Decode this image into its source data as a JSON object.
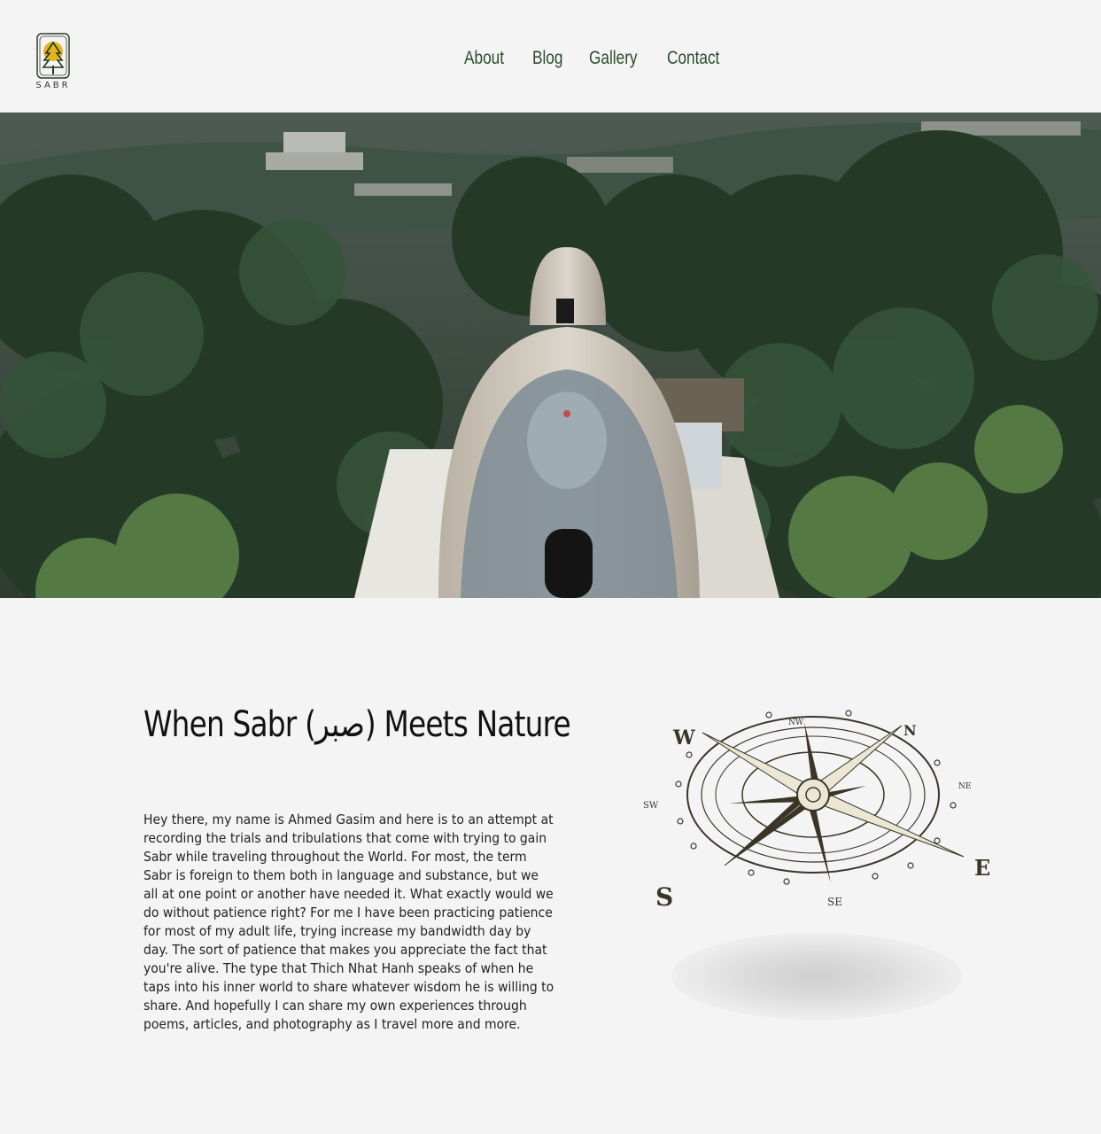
{
  "brand": {
    "name": "SABR",
    "icon": "tree-sun-logo-icon"
  },
  "nav": {
    "about": "About",
    "blog": "Blog",
    "gallery": "Gallery",
    "contact": "Contact"
  },
  "hero": {
    "image": "forest-dome-mural-photo"
  },
  "main": {
    "title": "When Sabr (صبر) Meets Nature",
    "intro": "Hey there, my name is Ahmed Gasim and here is to an attempt at recording the trials and tribulations that come with trying to gain Sabr while traveling throughout the World. For most, the term Sabr is foreign to them both in language and substance, but we all at one point or another have needed it. What exactly would we do without patience right? For me I have been practicing patience for most of my adult life, trying increase my bandwidth day by day. The sort of patience that makes you appreciate the fact that you're alive. The type that Thich Nhat Hanh speaks of when he taps into his inner world to share whatever wisdom he is willing to share. And hopefully I can share my own experiences through poems, articles, and photography as I travel more and more."
  },
  "compass": {
    "icon": "compass-rose-icon",
    "labels": {
      "w": "W",
      "n": "N",
      "s": "S",
      "e": "E",
      "nw": "NW",
      "ne": "NE",
      "sw": "SW",
      "se": "SE"
    }
  },
  "colors": {
    "background": "#f4f4f4",
    "nav": "#2d4a2b",
    "text": "#222222",
    "compass": "#3a3527"
  }
}
